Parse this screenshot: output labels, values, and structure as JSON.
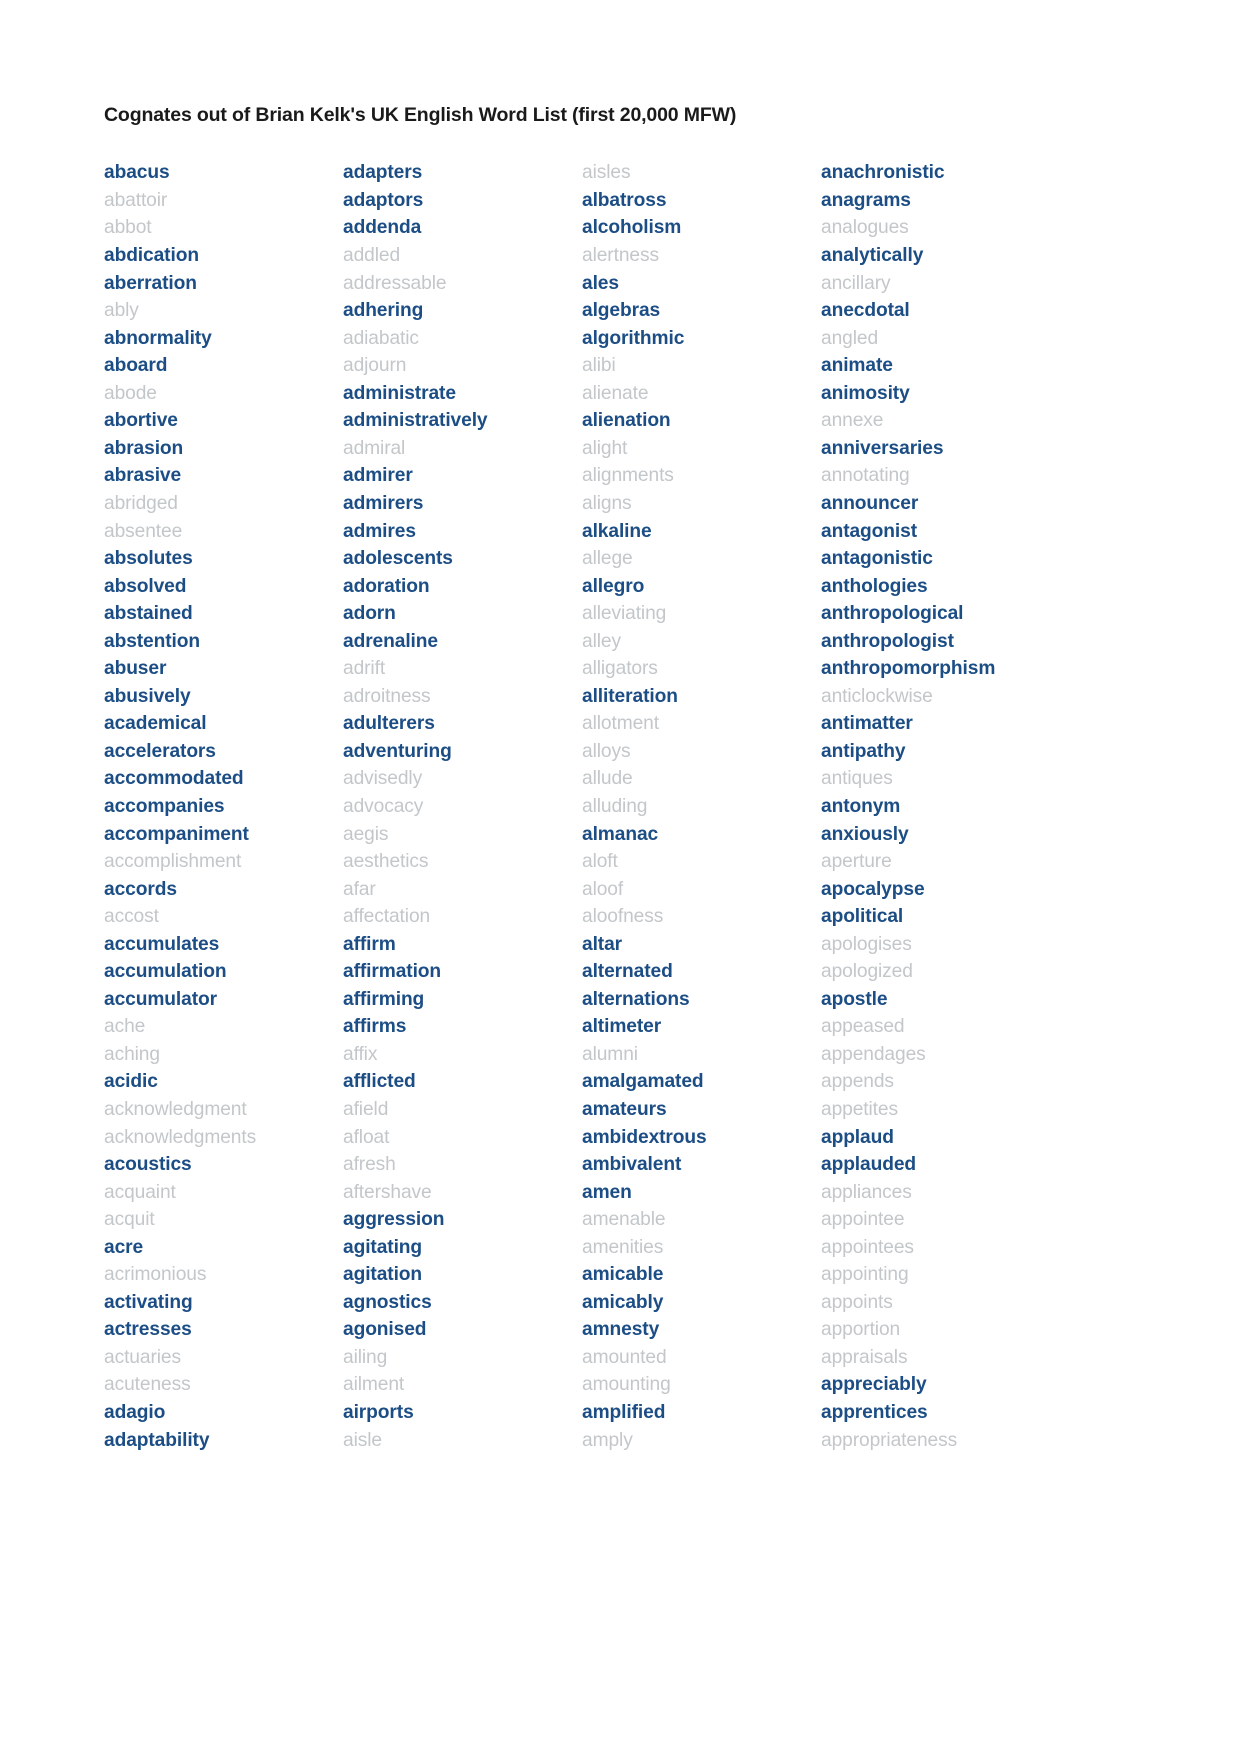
{
  "document": {
    "title": "Cognates out of Brian Kelk's UK English Word List (first 20,000 MFW)",
    "colors": {
      "cognate": "#1c4e85",
      "plain": "#c3c7ca",
      "title": "#1a1a1a",
      "background": "#ffffff"
    }
  },
  "columns": [
    {
      "index": 1,
      "words": [
        {
          "text": "abacus",
          "cognate": true
        },
        {
          "text": "abattoir",
          "cognate": false
        },
        {
          "text": "abbot",
          "cognate": false
        },
        {
          "text": "abdication",
          "cognate": true
        },
        {
          "text": "aberration",
          "cognate": true
        },
        {
          "text": "ably",
          "cognate": false
        },
        {
          "text": "abnormality",
          "cognate": true
        },
        {
          "text": "aboard",
          "cognate": true
        },
        {
          "text": "abode",
          "cognate": false
        },
        {
          "text": "abortive",
          "cognate": true
        },
        {
          "text": "abrasion",
          "cognate": true
        },
        {
          "text": "abrasive",
          "cognate": true
        },
        {
          "text": "abridged",
          "cognate": false
        },
        {
          "text": "absentee",
          "cognate": false
        },
        {
          "text": "absolutes",
          "cognate": true
        },
        {
          "text": "absolved",
          "cognate": true
        },
        {
          "text": "abstained",
          "cognate": true
        },
        {
          "text": "abstention",
          "cognate": true
        },
        {
          "text": "abuser",
          "cognate": true
        },
        {
          "text": "abusively",
          "cognate": true
        },
        {
          "text": "academical",
          "cognate": true
        },
        {
          "text": "accelerators",
          "cognate": true
        },
        {
          "text": "accommodated",
          "cognate": true
        },
        {
          "text": "accompanies",
          "cognate": true
        },
        {
          "text": "accompaniment",
          "cognate": true
        },
        {
          "text": "accomplishment",
          "cognate": false
        },
        {
          "text": "accords",
          "cognate": true
        },
        {
          "text": "accost",
          "cognate": false
        },
        {
          "text": "accumulates",
          "cognate": true
        },
        {
          "text": "accumulation",
          "cognate": true
        },
        {
          "text": "accumulator",
          "cognate": true
        },
        {
          "text": "ache",
          "cognate": false
        },
        {
          "text": "aching",
          "cognate": false
        },
        {
          "text": "acidic",
          "cognate": true
        },
        {
          "text": "acknowledgment",
          "cognate": false
        },
        {
          "text": "acknowledgments",
          "cognate": false
        },
        {
          "text": "acoustics",
          "cognate": true
        },
        {
          "text": "acquaint",
          "cognate": false
        },
        {
          "text": "acquit",
          "cognate": false
        },
        {
          "text": "acre",
          "cognate": true
        },
        {
          "text": "acrimonious",
          "cognate": false
        },
        {
          "text": "activating",
          "cognate": true
        },
        {
          "text": "actresses",
          "cognate": true
        },
        {
          "text": "actuaries",
          "cognate": false
        },
        {
          "text": "acuteness",
          "cognate": false
        },
        {
          "text": "adagio",
          "cognate": true
        },
        {
          "text": "adaptability",
          "cognate": true
        }
      ]
    },
    {
      "index": 2,
      "words": [
        {
          "text": "adapters",
          "cognate": true
        },
        {
          "text": "adaptors",
          "cognate": true
        },
        {
          "text": "addenda",
          "cognate": true
        },
        {
          "text": "addled",
          "cognate": false
        },
        {
          "text": "addressable",
          "cognate": false
        },
        {
          "text": "adhering",
          "cognate": true
        },
        {
          "text": "adiabatic",
          "cognate": false
        },
        {
          "text": "adjourn",
          "cognate": false
        },
        {
          "text": "administrate",
          "cognate": true
        },
        {
          "text": "administratively",
          "cognate": true
        },
        {
          "text": "admiral",
          "cognate": false
        },
        {
          "text": "admirer",
          "cognate": true
        },
        {
          "text": "admirers",
          "cognate": true
        },
        {
          "text": "admires",
          "cognate": true
        },
        {
          "text": "adolescents",
          "cognate": true
        },
        {
          "text": "adoration",
          "cognate": true
        },
        {
          "text": "adorn",
          "cognate": true
        },
        {
          "text": "adrenaline",
          "cognate": true
        },
        {
          "text": "adrift",
          "cognate": false
        },
        {
          "text": "adroitness",
          "cognate": false
        },
        {
          "text": "adulterers",
          "cognate": true
        },
        {
          "text": "adventuring",
          "cognate": true
        },
        {
          "text": "advisedly",
          "cognate": false
        },
        {
          "text": "advocacy",
          "cognate": false
        },
        {
          "text": "aegis",
          "cognate": false
        },
        {
          "text": "aesthetics",
          "cognate": false
        },
        {
          "text": "afar",
          "cognate": false
        },
        {
          "text": "affectation",
          "cognate": false
        },
        {
          "text": "affirm",
          "cognate": true
        },
        {
          "text": "affirmation",
          "cognate": true
        },
        {
          "text": "affirming",
          "cognate": true
        },
        {
          "text": "affirms",
          "cognate": true
        },
        {
          "text": "affix",
          "cognate": false
        },
        {
          "text": "afflicted",
          "cognate": true
        },
        {
          "text": "afield",
          "cognate": false
        },
        {
          "text": "afloat",
          "cognate": false
        },
        {
          "text": "afresh",
          "cognate": false
        },
        {
          "text": "aftershave",
          "cognate": false
        },
        {
          "text": "aggression",
          "cognate": true
        },
        {
          "text": "agitating",
          "cognate": true
        },
        {
          "text": "agitation",
          "cognate": true
        },
        {
          "text": "agnostics",
          "cognate": true
        },
        {
          "text": "agonised",
          "cognate": true
        },
        {
          "text": "ailing",
          "cognate": false
        },
        {
          "text": "ailment",
          "cognate": false
        },
        {
          "text": "airports",
          "cognate": true
        },
        {
          "text": "aisle",
          "cognate": false
        }
      ]
    },
    {
      "index": 3,
      "words": [
        {
          "text": "aisles",
          "cognate": false
        },
        {
          "text": "albatross",
          "cognate": true
        },
        {
          "text": "alcoholism",
          "cognate": true
        },
        {
          "text": "alertness",
          "cognate": false
        },
        {
          "text": "ales",
          "cognate": true
        },
        {
          "text": "algebras",
          "cognate": true
        },
        {
          "text": "algorithmic",
          "cognate": true
        },
        {
          "text": "alibi",
          "cognate": false
        },
        {
          "text": "alienate",
          "cognate": false
        },
        {
          "text": "alienation",
          "cognate": true
        },
        {
          "text": "alight",
          "cognate": false
        },
        {
          "text": "alignments",
          "cognate": false
        },
        {
          "text": "aligns",
          "cognate": false
        },
        {
          "text": "alkaline",
          "cognate": true
        },
        {
          "text": "allege",
          "cognate": false
        },
        {
          "text": "allegro",
          "cognate": true
        },
        {
          "text": "alleviating",
          "cognate": false
        },
        {
          "text": "alley",
          "cognate": false
        },
        {
          "text": "alligators",
          "cognate": false
        },
        {
          "text": "alliteration",
          "cognate": true
        },
        {
          "text": "allotment",
          "cognate": false
        },
        {
          "text": "alloys",
          "cognate": false
        },
        {
          "text": "allude",
          "cognate": false
        },
        {
          "text": "alluding",
          "cognate": false
        },
        {
          "text": "almanac",
          "cognate": true
        },
        {
          "text": "aloft",
          "cognate": false
        },
        {
          "text": "aloof",
          "cognate": false
        },
        {
          "text": "aloofness",
          "cognate": false
        },
        {
          "text": "altar",
          "cognate": true
        },
        {
          "text": "alternated",
          "cognate": true
        },
        {
          "text": "alternations",
          "cognate": true
        },
        {
          "text": "altimeter",
          "cognate": true
        },
        {
          "text": "alumni",
          "cognate": false
        },
        {
          "text": "amalgamated",
          "cognate": true
        },
        {
          "text": "amateurs",
          "cognate": true
        },
        {
          "text": "ambidextrous",
          "cognate": true
        },
        {
          "text": "ambivalent",
          "cognate": true
        },
        {
          "text": "amen",
          "cognate": true
        },
        {
          "text": "amenable",
          "cognate": false
        },
        {
          "text": "amenities",
          "cognate": false
        },
        {
          "text": "amicable",
          "cognate": true
        },
        {
          "text": "amicably",
          "cognate": true
        },
        {
          "text": "amnesty",
          "cognate": true
        },
        {
          "text": "amounted",
          "cognate": false
        },
        {
          "text": "amounting",
          "cognate": false
        },
        {
          "text": "amplified",
          "cognate": true
        },
        {
          "text": "amply",
          "cognate": false
        }
      ]
    },
    {
      "index": 4,
      "words": [
        {
          "text": "anachronistic",
          "cognate": true
        },
        {
          "text": "anagrams",
          "cognate": true
        },
        {
          "text": "analogues",
          "cognate": false
        },
        {
          "text": "analytically",
          "cognate": true
        },
        {
          "text": "ancillary",
          "cognate": false
        },
        {
          "text": "anecdotal",
          "cognate": true
        },
        {
          "text": "angled",
          "cognate": false
        },
        {
          "text": "animate",
          "cognate": true
        },
        {
          "text": "animosity",
          "cognate": true
        },
        {
          "text": "annexe",
          "cognate": false
        },
        {
          "text": "anniversaries",
          "cognate": true
        },
        {
          "text": "annotating",
          "cognate": false
        },
        {
          "text": "announcer",
          "cognate": true
        },
        {
          "text": "antagonist",
          "cognate": true
        },
        {
          "text": "antagonistic",
          "cognate": true
        },
        {
          "text": "anthologies",
          "cognate": true
        },
        {
          "text": "anthropological",
          "cognate": true
        },
        {
          "text": "anthropologist",
          "cognate": true
        },
        {
          "text": "anthropomorphism",
          "cognate": true
        },
        {
          "text": "anticlockwise",
          "cognate": false
        },
        {
          "text": "antimatter",
          "cognate": true
        },
        {
          "text": "antipathy",
          "cognate": true
        },
        {
          "text": "antiques",
          "cognate": false
        },
        {
          "text": "antonym",
          "cognate": true
        },
        {
          "text": "anxiously",
          "cognate": true
        },
        {
          "text": "aperture",
          "cognate": false
        },
        {
          "text": "apocalypse",
          "cognate": true
        },
        {
          "text": "apolitical",
          "cognate": true
        },
        {
          "text": "apologises",
          "cognate": false
        },
        {
          "text": "apologized",
          "cognate": false
        },
        {
          "text": "apostle",
          "cognate": true
        },
        {
          "text": "appeased",
          "cognate": false
        },
        {
          "text": "appendages",
          "cognate": false
        },
        {
          "text": "appends",
          "cognate": false
        },
        {
          "text": "appetites",
          "cognate": false
        },
        {
          "text": "applaud",
          "cognate": true
        },
        {
          "text": "applauded",
          "cognate": true
        },
        {
          "text": "appliances",
          "cognate": false
        },
        {
          "text": "appointee",
          "cognate": false
        },
        {
          "text": "appointees",
          "cognate": false
        },
        {
          "text": "appointing",
          "cognate": false
        },
        {
          "text": "appoints",
          "cognate": false
        },
        {
          "text": "apportion",
          "cognate": false
        },
        {
          "text": "appraisals",
          "cognate": false
        },
        {
          "text": "appreciably",
          "cognate": true
        },
        {
          "text": "apprentices",
          "cognate": true
        },
        {
          "text": "appropriateness",
          "cognate": false
        }
      ]
    }
  ]
}
